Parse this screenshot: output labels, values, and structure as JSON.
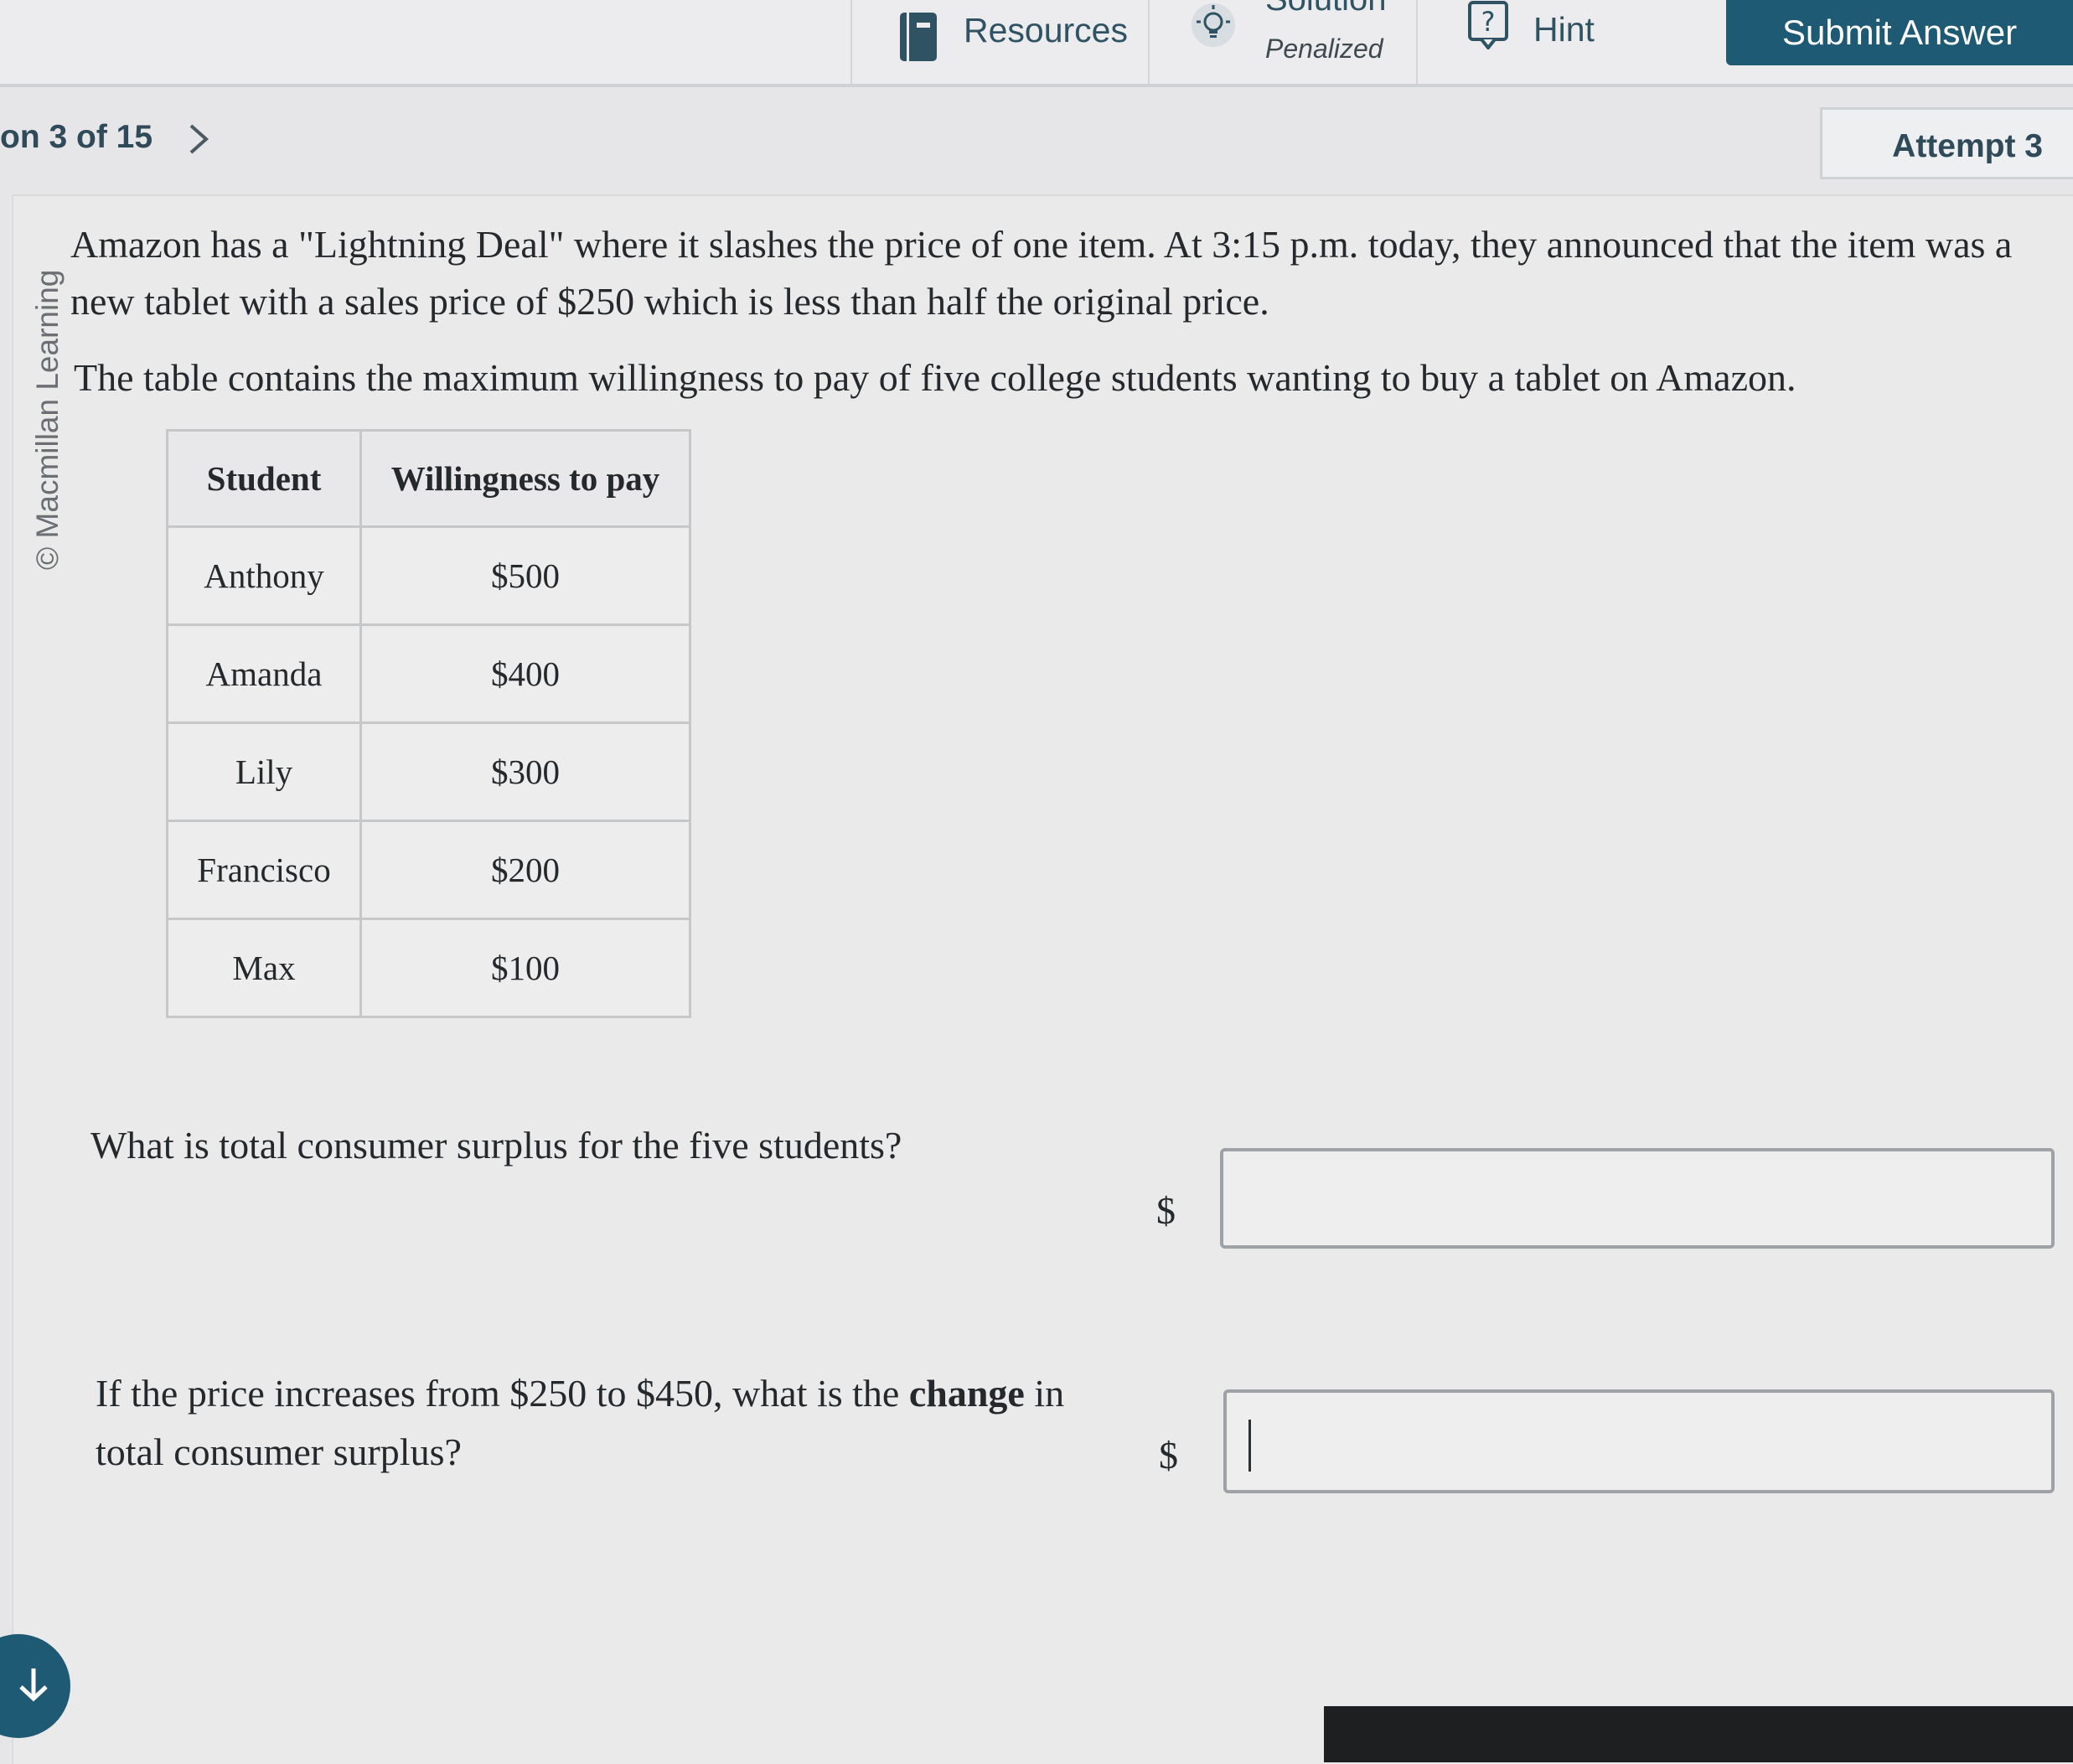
{
  "toolbar": {
    "resources_label": "Resources",
    "solution_label": "Solution",
    "solution_note": "Penalized",
    "hint_label": "Hint",
    "submit_label": "Submit Answer",
    "icons": [
      "book-icon",
      "lightbulb-icon",
      "question-icon"
    ]
  },
  "nav": {
    "counter": "on 3 of 15",
    "attempt": "Attempt 3"
  },
  "copyright": "© Macmillan Learning",
  "question": {
    "paragraph1": "Amazon has a \"Lightning Deal\" where it slashes the price of one item. At 3:15 p.m. today, they announced that the item was a new tablet with a sales price of $250 which is less than half the original price.",
    "paragraph2": "The table contains the maximum willingness to pay of five college students wanting to buy a tablet on Amazon.",
    "table": {
      "headers": [
        "Student",
        "Willingness to pay"
      ],
      "rows": [
        [
          "Anthony",
          "$500"
        ],
        [
          "Amanda",
          "$400"
        ],
        [
          "Lily",
          "$300"
        ],
        [
          "Francisco",
          "$200"
        ],
        [
          "Max",
          "$100"
        ]
      ]
    },
    "part1": {
      "prompt": "What is total consumer surplus for the five students?",
      "unit": "$",
      "value": ""
    },
    "part2": {
      "prompt_before": "If the price increases from $250 to $450, what is the ",
      "prompt_bold": "change",
      "prompt_after": " in total consumer surplus?",
      "unit": "$",
      "value": ""
    }
  },
  "colors": {
    "primary": "#1f5a74",
    "toolbar_text": "#2f5363",
    "background": "#e6e6e8"
  }
}
